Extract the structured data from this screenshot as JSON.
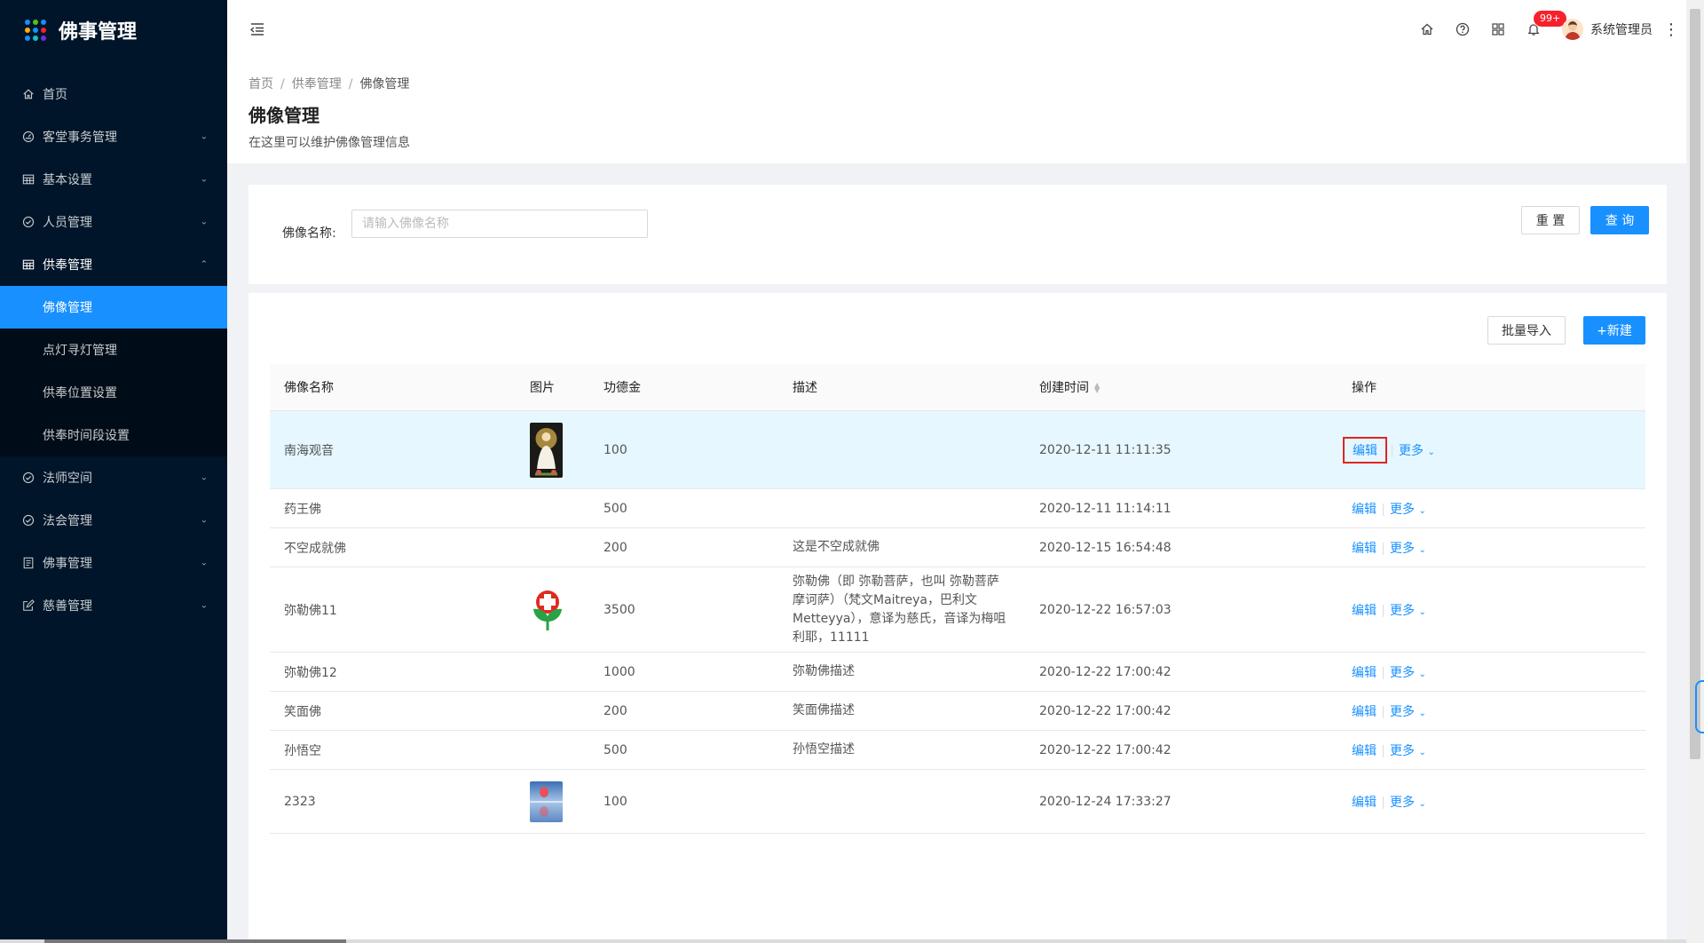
{
  "app": {
    "title": "佛事管理"
  },
  "colors": {
    "primary": "#1890ff",
    "sidebar_bg": "#001529",
    "highlight_row": "#e6f7ff",
    "annotation_box": "#e0261f",
    "badge": "#f5222d"
  },
  "sidebar": {
    "items": [
      {
        "label": "首页",
        "icon": "home-icon"
      },
      {
        "label": "客堂事务管理",
        "icon": "dashboard-icon",
        "has_children": true
      },
      {
        "label": "基本设置",
        "icon": "table-icon",
        "has_children": true
      },
      {
        "label": "人员管理",
        "icon": "check-circle-icon",
        "has_children": true
      },
      {
        "label": "供奉管理",
        "icon": "table-icon",
        "has_children": true,
        "expanded": true,
        "children": [
          {
            "label": "佛像管理",
            "active": true
          },
          {
            "label": "点灯寻灯管理"
          },
          {
            "label": "供奉位置设置"
          },
          {
            "label": "供奉时间段设置"
          }
        ]
      },
      {
        "label": "法师空间",
        "icon": "check-circle-icon",
        "has_children": true
      },
      {
        "label": "法会管理",
        "icon": "check-circle-icon",
        "has_children": true
      },
      {
        "label": "佛事管理",
        "icon": "profile-icon",
        "has_children": true
      },
      {
        "label": "慈善管理",
        "icon": "form-icon",
        "has_children": true
      }
    ]
  },
  "header": {
    "icons": [
      "menu-fold-icon",
      "home-icon",
      "question-circle-icon",
      "appstore-icon",
      "bell-icon"
    ],
    "notification_badge": "99+",
    "user_name": "系统管理员"
  },
  "breadcrumb": [
    "首页",
    "供奉管理",
    "佛像管理"
  ],
  "page": {
    "title": "佛像管理",
    "description": "在这里可以维护佛像管理信息"
  },
  "search": {
    "label": "佛像名称:",
    "placeholder": "请输入佛像名称",
    "value": "",
    "reset_label": "重 置",
    "query_label": "查 询"
  },
  "toolbar": {
    "import_label": "批量导入",
    "new_label": "+新建"
  },
  "table": {
    "columns": [
      "佛像名称",
      "图片",
      "功德金",
      "描述",
      "创建时间",
      "操作"
    ],
    "edit_label": "编辑",
    "more_label": "更多",
    "rows": [
      {
        "name": "南海观音",
        "image": "guanyin",
        "amount": "100",
        "description": "",
        "created": "2020-12-11 11:11:35",
        "highlighted": true
      },
      {
        "name": "药王佛",
        "image": "",
        "amount": "500",
        "description": "",
        "created": "2020-12-11 11:14:11"
      },
      {
        "name": "不空成就佛",
        "image": "",
        "amount": "200",
        "description": "这是不空成就佛",
        "created": "2020-12-15 16:54:48"
      },
      {
        "name": "弥勒佛11",
        "image": "red-cross-logo",
        "amount": "3500",
        "description": "弥勒佛（即 弥勒菩萨，也叫 弥勒菩萨摩诃萨）（梵文Maitreya，巴利文Metteyya），意译为慈氏，音译为梅咀利耶，11111",
        "created": "2020-12-22 16:57:03"
      },
      {
        "name": "弥勒佛12",
        "image": "",
        "amount": "1000",
        "description": "弥勒佛描述",
        "created": "2020-12-22 17:00:42"
      },
      {
        "name": "笑面佛",
        "image": "",
        "amount": "200",
        "description": "笑面佛描述",
        "created": "2020-12-22 17:00:42"
      },
      {
        "name": "孙悟空",
        "image": "",
        "amount": "500",
        "description": "孙悟空描述",
        "created": "2020-12-22 17:00:42"
      },
      {
        "name": "2323",
        "image": "balloon-photo",
        "amount": "100",
        "description": "",
        "created": "2020-12-24 17:33:27"
      }
    ]
  }
}
